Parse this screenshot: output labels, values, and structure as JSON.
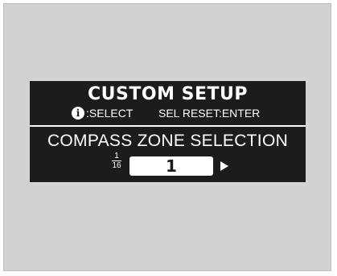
{
  "screen": {
    "title": "CUSTOM SETUP",
    "hint_icon": "info-icon",
    "hint_select": ":SELECT",
    "hint_reset": "SEL RESET:ENTER",
    "subtitle": "COMPASS ZONE SELECTION",
    "fraction_numerator": "1",
    "fraction_denominator": "16",
    "value": "1",
    "arrow_icon": "right-arrow-icon"
  },
  "colors": {
    "background": "#d2d2d2",
    "screen": "#1c1c1c",
    "text": "#ffffff"
  }
}
